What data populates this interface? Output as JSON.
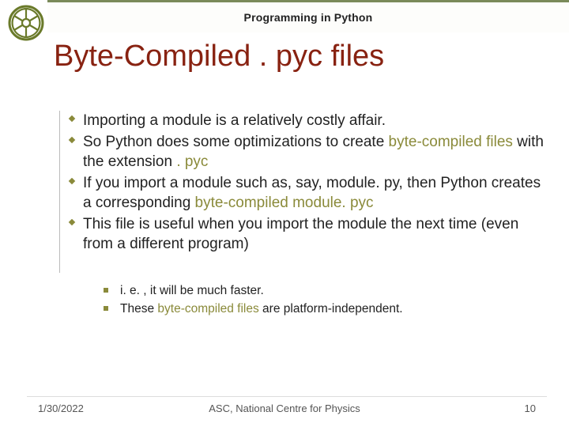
{
  "header": {
    "subtitle": "Programming in Python",
    "title": "Byte-Compiled . pyc files"
  },
  "bullets": {
    "b1": "Importing a module is a relatively costly affair.",
    "b2_a": "So Python does some optimizations to create ",
    "b2_hl": "byte-compiled files",
    "b2_b": " with the extension ",
    "b2_hl2": ". pyc",
    "b3_a": "If you import a module such as, say, module. py, then Python creates a corresponding ",
    "b3_hl": "byte-compiled module. pyc",
    "b4": "This file is useful when you import the module the next time (even from a different program)"
  },
  "sub": {
    "s1": "i. e. , it will be much faster.",
    "s2_a": "These ",
    "s2_hl": "byte-compiled files",
    "s2_b": " are platform-independent."
  },
  "footer": {
    "date": "1/30/2022",
    "center": "ASC, National Centre for Physics",
    "page": "10"
  }
}
